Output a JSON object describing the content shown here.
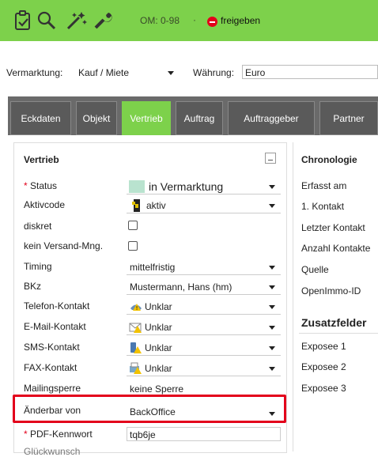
{
  "toolbar": {
    "icons": [
      "clipboard-check-icon",
      "magnifier-icon",
      "magic-wand-icon",
      "wrench-icon"
    ],
    "om_label": "OM: 0-98",
    "separator": "·",
    "status_label": "freigeben",
    "status_color": "#e3001b",
    "bg_color": "#7dd14b"
  },
  "filters": {
    "marketing_label": "Vermarktung:",
    "marketing_value": "Kauf / Miete",
    "currency_label": "Währung:",
    "currency_value": "Euro"
  },
  "tabs": [
    {
      "label": "Eckdaten"
    },
    {
      "label": "Objekt"
    },
    {
      "label": "Vertrieb",
      "active": true
    },
    {
      "label": "Auftrag"
    },
    {
      "label": "Auftraggeber"
    },
    {
      "label": "Partner"
    }
  ],
  "vertrieb": {
    "title": "Vertrieb",
    "rows": [
      {
        "label": "Status",
        "required": true,
        "value": "in Vermarktung",
        "icon": "status-color-swatch-icon"
      },
      {
        "label": "Aktivcode",
        "value": "aktiv",
        "icon": "traffic-light-icon"
      },
      {
        "label": "diskret",
        "type": "checkbox"
      },
      {
        "label": "kein Versand-Mng.",
        "type": "checkbox"
      },
      {
        "label": "Timing",
        "value": "mittelfristig"
      },
      {
        "label": "BKz",
        "value": "Mustermann, Hans (hm)"
      },
      {
        "label": "Telefon-Kontakt",
        "value": "Unklar",
        "icon": "phone-contact-icon"
      },
      {
        "label": "E-Mail-Kontakt",
        "value": "Unklar",
        "icon": "email-contact-icon"
      },
      {
        "label": "SMS-Kontakt",
        "value": "Unklar",
        "icon": "sms-contact-icon"
      },
      {
        "label": "FAX-Kontakt",
        "value": "Unklar",
        "icon": "fax-contact-icon"
      },
      {
        "label": "Mailingsperre",
        "value": "keine Sperre"
      },
      {
        "label": "Änderbar von",
        "value": "BackOffice"
      },
      {
        "label": "PDF-Kennwort",
        "required": true,
        "value": "tqb6je"
      },
      {
        "label": "Glückwunsch"
      }
    ]
  },
  "chronologie": {
    "title": "Chronologie",
    "rows": [
      "Erfasst am",
      "1. Kontakt",
      "Letzter Kontakt",
      "Anzahl Kontakte",
      "Quelle",
      "OpenImmo-ID"
    ]
  },
  "zusatzfelder": {
    "title": "Zusatzfelder",
    "rows": [
      "Exposee 1",
      "Exposee 2",
      "Exposee 3"
    ]
  },
  "highlight_color": "#e3001b"
}
